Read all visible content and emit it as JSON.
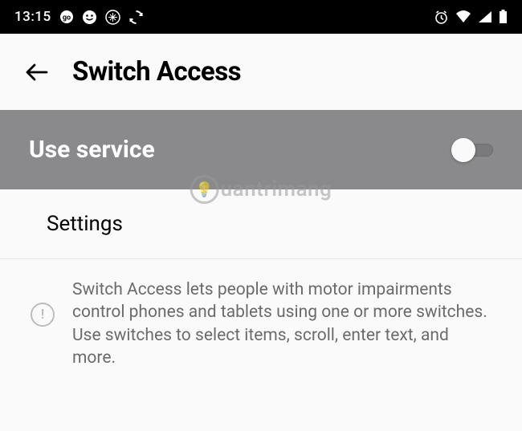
{
  "statusbar": {
    "time": "13:15"
  },
  "header": {
    "title": "Switch Access"
  },
  "toggle": {
    "label": "Use service",
    "state": "off"
  },
  "settings": {
    "label": "Settings"
  },
  "info": {
    "text": "Switch Access lets people with motor impairments control phones and tablets using one or more switches. Use switches to select items, scroll, enter text, and more."
  },
  "watermark": {
    "text": "uantrimang"
  }
}
